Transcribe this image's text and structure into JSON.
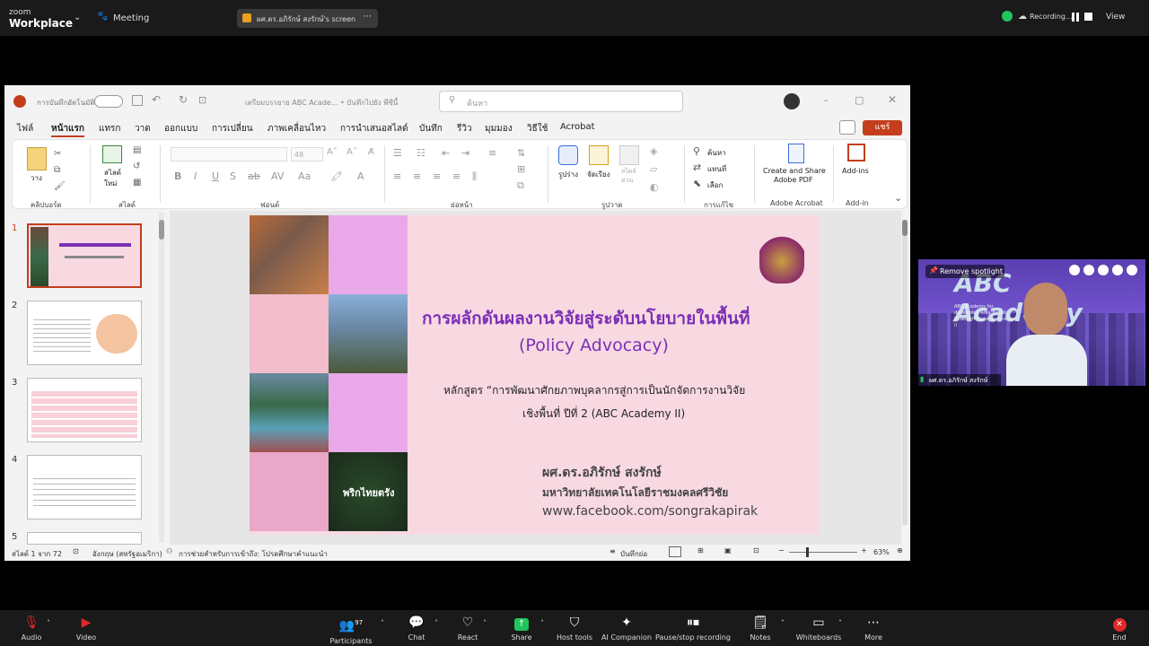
{
  "zoom": {
    "logo_line1": "zoom",
    "logo_line2": "Workplace",
    "meeting_label": "Meeting",
    "share_title": "ผศ.ดร.อภิรักษ์ สงรักษ์'s screen",
    "recording_label": "Recording...",
    "view_label": "View"
  },
  "ppt": {
    "autosave_label": "การบันทึกอัตโนมัติ",
    "doc_title": "เตรียมบรรยาย ABC Acade... • บันทึกไปยัง พีซีนี้",
    "search_placeholder": "ค้นหา",
    "menu": [
      "ไฟล์",
      "หน้าแรก",
      "แทรก",
      "วาด",
      "ออกแบบ",
      "การเปลี่ยน",
      "ภาพเคลื่อนไหว",
      "การนำเสนอสไลด์",
      "บันทึก",
      "รีวิว",
      "มุมมอง",
      "วิธีใช้",
      "Acrobat"
    ],
    "share_button": "แชร์",
    "ribbon": {
      "paste": "วาง",
      "clipboard": "คลิปบอร์ด",
      "new_slide_1": "สไลด์",
      "new_slide_2": "ใหม่",
      "slides": "สไลด์",
      "font_size": "48",
      "font_group": "ฟอนต์",
      "paragraph": "ย่อหน้า",
      "shape": "รูปร่าง",
      "arrange": "จัดเรียง",
      "quick_style_1": "สไตล์",
      "quick_style_2": "ด่วน",
      "drawing": "รูปวาด",
      "find": "ค้นหา",
      "replace": "แทนที่",
      "select": "เลือก",
      "editing": "การแก้ไข",
      "create_pdf_1": "Create and Share",
      "create_pdf_2": "Adobe PDF",
      "adobe_acrobat": "Adobe Acrobat",
      "addins": "Add-ins",
      "addin": "Add-in"
    },
    "thumbnails": [
      "1",
      "2",
      "3",
      "4",
      "5"
    ],
    "slide": {
      "title": "การผลักดันผลงานวิจัยสู่ระดับนโยบายในพื้นที่",
      "title_en": "(Policy Advocacy)",
      "course_line1": "หลักสูตร “การพัฒนาศักยภาพบุคลากรสู่การเป็นนักจัดการงานวิจัย",
      "course_line2": "เชิงพื้นที่ ปีที่ 2 (ABC Academy II)",
      "presenter": "ผศ.ดร.อภิรักษ์ สงรักษ์",
      "university": "มหาวิทยาลัยเทคโนโลยีราชมงคลศรีวิชัย",
      "facebook": "www.facebook.com/songrakapirak",
      "photo_caption": "พริกไทยตรัง"
    },
    "status": {
      "slide_count": "สไลด์ 1 จาก 72",
      "language": "อังกฤษ (สหรัฐอเมริกา)",
      "accessibility": "การช่วยสำหรับการเข้าถึง: โปรดศึกษาคำแนะนำ",
      "notes": "บันทึกย่อ",
      "zoom": "63%"
    }
  },
  "video": {
    "spotlight": "Remove spotlight",
    "name": "ผศ.ดร.อภิรักษ์ สงรักษ์",
    "banner_title": "ABC Academy",
    "banner_sub": "ABC Academy for developing Area Based Research Manager Episode II"
  },
  "toolbar": {
    "audio": "Audio",
    "video": "Video",
    "participants": "Participants",
    "participants_count": "97",
    "chat": "Chat",
    "react": "React",
    "share": "Share",
    "host_tools": "Host tools",
    "ai_companion": "AI Companion",
    "recording": "Pause/stop recording",
    "notes": "Notes",
    "whiteboards": "Whiteboards",
    "more": "More",
    "end": "End"
  },
  "colors": {
    "zoom_bar": "#1a1a1a",
    "ppt_accent": "#c43e1c",
    "slide_bg": "#f8d9e2",
    "slide_title": "#7b2fb5",
    "share_green": "#21c55d",
    "end_red": "#e02828"
  }
}
